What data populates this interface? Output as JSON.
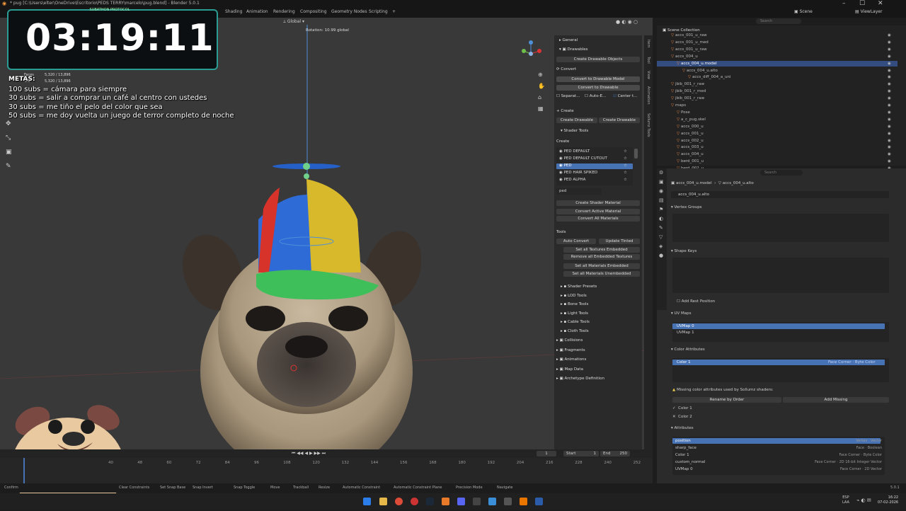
{
  "window": {
    "title": "* pug [C:\\Users\\elter\\OneDrive\\Escritorio\\PEDS TERRY\\marcelo\\pug.blend] - Blender 5.0.1",
    "tabs": [
      "Shading",
      "Animation",
      "Rendering",
      "Compositing",
      "Geometry Nodes",
      "Scripting",
      "+"
    ],
    "scene": "Scene",
    "view_layer": "ViewLayer",
    "controls": [
      "–",
      "☐",
      "✕"
    ]
  },
  "viewport": {
    "orientation": "Global",
    "rotation_text": "Rotation: 10.99 global",
    "stats_faces_label": "Faces",
    "stats_faces": "5,320 / 13,896",
    "stats_tris_label": "Tris",
    "stats_tris": "5,320 / 13,896"
  },
  "overlay": {
    "subathon": "SUBATHON PROTOCOL",
    "timer": "03:19:11",
    "metas_title": "METAS:",
    "goals": [
      "100 subs = cámara para siempre",
      "30 subs = salir a comprar un café al centro con ustedes",
      "30 subs = me tiño el pelo del color que sea",
      "50 subs = me doy vuelta un juego de terror completo de noche"
    ]
  },
  "sollumz": {
    "general": "General",
    "drawables": "Drawables",
    "create_drawable_objects": "Create Drawable Objects",
    "convert": "Convert",
    "convert_to_drawable_model": "Convert to Drawable Model",
    "convert_to_drawable": "Convert to Drawable",
    "separate": "Separat...",
    "auto_e": "Auto-E...",
    "center": "Center t...",
    "create_header": "Create",
    "create_drawable_1": "Create Drawable",
    "create_drawable_2": "Create Drawable",
    "shader_tools": "Shader Tools",
    "create_label": "Create",
    "shaders": [
      "PED DEFAULT",
      "PED DEFAULT CUTOUT",
      "PED",
      "PED HAIR SPIKED",
      "PED ALPHA"
    ],
    "shader_search": "ped",
    "create_shader_material": "Create Shader Material",
    "convert_active_material": "Convert Active Material",
    "convert_all_materials": "Convert All Materials",
    "tools": "Tools",
    "auto_convert": "Auto Convert",
    "update_tinted": "Update Tinted",
    "set_all_textures_embedded": "Set all Textures Embedded",
    "remove_all_embedded_textures": "Remove all Embedded Textures",
    "set_all_materials_embedded": "Set all Materials Embedded",
    "set_all_materials_unembedded": "Set all Materials Unembedded",
    "subpanels": [
      "Shader Presets",
      "LOD Tools",
      "Bone Tools",
      "Light Tools",
      "Cable Tools",
      "Cloth Tools"
    ],
    "sections": [
      "Collisions",
      "Fragments",
      "Animations",
      "Map Data",
      "Archetype Definition"
    ]
  },
  "sidebar_tabs": [
    "Item",
    "Tool",
    "View",
    "Animation",
    "Sollumz Tools"
  ],
  "outliner": {
    "search_placeholder": "Search",
    "scene_collection": "Scene Collection",
    "items": [
      {
        "label": "accs_001_u_raw",
        "indent": 1
      },
      {
        "label": "accs_001_u_med",
        "indent": 1
      },
      {
        "label": "accs_001_u_raw",
        "indent": 1
      },
      {
        "label": "accs_004_u",
        "indent": 1
      },
      {
        "label": "accs_004_u.model",
        "indent": 2,
        "selected": true
      },
      {
        "label": "accs_004_u.alto",
        "indent": 3
      },
      {
        "label": "accs_diff_004_a_uni",
        "indent": 4
      },
      {
        "label": "jbib_001_r_raw",
        "indent": 1
      },
      {
        "label": "jbib_001_r_med",
        "indent": 1
      },
      {
        "label": "jbib_001_r_raw",
        "indent": 1
      },
      {
        "label": "maps",
        "indent": 1
      },
      {
        "label": "Pose",
        "indent": 2
      },
      {
        "label": "a_c_pug.skel",
        "indent": 2
      },
      {
        "label": "accs_000_u",
        "indent": 2
      },
      {
        "label": "accs_001_u",
        "indent": 2
      },
      {
        "label": "accs_002_u",
        "indent": 2
      },
      {
        "label": "accs_003_u",
        "indent": 2
      },
      {
        "label": "accs_004_u",
        "indent": 2
      },
      {
        "label": "berd_001_u",
        "indent": 2
      },
      {
        "label": "berd_002_u",
        "indent": 2
      }
    ]
  },
  "properties": {
    "search_placeholder": "Search",
    "breadcrumb_object": "accs_004_u.model",
    "breadcrumb_mesh": "accs_004_u.alto",
    "datablock": "accs_004_u.alto",
    "vertex_groups": "Vertex Groups",
    "shape_keys": "Shape Keys",
    "add_rest_position": "Add Rest Position",
    "uv_maps": "UV Maps",
    "uv_items": [
      "UVMap 0",
      "UVMap 1"
    ],
    "color_attributes": "Color Attributes",
    "color_item": "Color 1",
    "color_item_type": "Face Corner · Byte Color",
    "missing_warning": "Missing color attributes used by Sollumz shaders:",
    "rename_by_order": "Rename by Order",
    "add_missing": "Add Missing",
    "color_checks": [
      {
        "mark": "✓",
        "label": "Color 1"
      },
      {
        "mark": "✕",
        "label": "Color 2"
      }
    ],
    "attributes": "Attributes",
    "attribute_rows": [
      {
        "name": "position",
        "domain": "Vertex · Vector",
        "selected": true
      },
      {
        "name": "sharp_face",
        "domain": "Face · Boolean"
      },
      {
        "name": "Color 1",
        "domain": "Face Corner · Byte Color"
      },
      {
        "name": "custom_normal",
        "domain": "Face Corner · 2D 16-bit Integer Vector"
      },
      {
        "name": "UVMap 0",
        "domain": "Face Corner · 2D Vector"
      }
    ]
  },
  "timeline": {
    "current_frame": "1",
    "start_label": "Start",
    "start": "1",
    "end_label": "End",
    "end": "250",
    "ticks": [
      "40",
      "48",
      "60",
      "72",
      "84",
      "96",
      "108",
      "120",
      "132",
      "144",
      "156",
      "168",
      "180",
      "192",
      "204",
      "216",
      "228",
      "240",
      "252"
    ]
  },
  "statusbar": {
    "items": [
      "Confirm",
      "Clear Constraints",
      "Set Snap Base",
      "Snap Invert",
      "Snap Toggle",
      "Move",
      "Trackball",
      "Resize",
      "Automatic Constraint",
      "Automatic Constraint Plane",
      "Precision Mode",
      "Navigate"
    ],
    "version": "5.0.1"
  },
  "taskbar": {
    "lang": "ESP",
    "region": "LAA",
    "time": "16:22",
    "date": "07-02-2026"
  },
  "colors": {
    "accent": "#4772b3",
    "timer_border": "#2a9c93",
    "selection_orange": "#ff9e3d"
  }
}
